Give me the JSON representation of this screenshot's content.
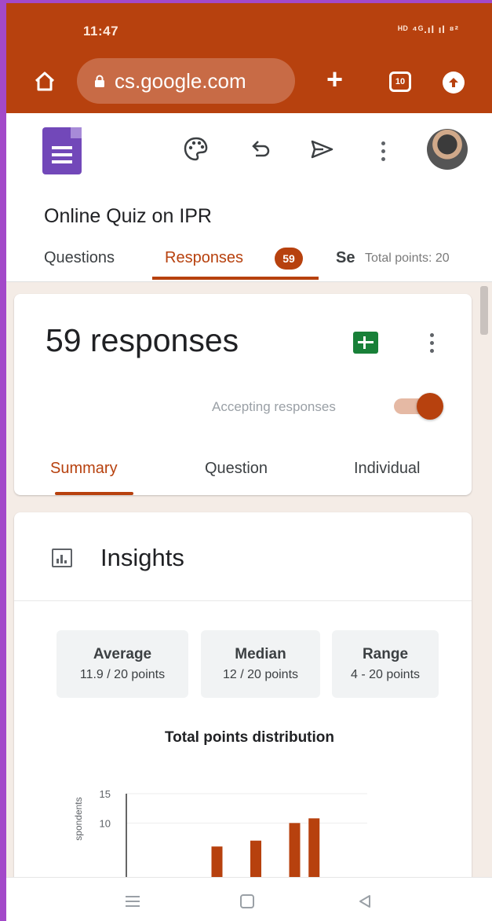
{
  "status_bar": {
    "time": "11:47",
    "icons_text": "ᴴᴰ ⁴ᴳ.ıl ıl ⁸²"
  },
  "browser": {
    "url": "cs.google.com",
    "tab_count": "10"
  },
  "form": {
    "title": "Online Quiz on IPR",
    "tabs": [
      {
        "label": "Questions"
      },
      {
        "label": "Responses",
        "badge": "59"
      },
      {
        "label": "Se"
      }
    ],
    "total_points": "Total points: 20"
  },
  "responses": {
    "count_label": "59 responses",
    "accepting_label": "Accepting responses",
    "accepting_on": true,
    "subtabs": [
      "Summary",
      "Question",
      "Individual"
    ]
  },
  "insights": {
    "title": "Insights",
    "stats": [
      {
        "label": "Average",
        "value": "11.9 / 20 points"
      },
      {
        "label": "Median",
        "value": "12 / 20 points"
      },
      {
        "label": "Range",
        "value": "4 - 20 points"
      }
    ]
  },
  "chart_data": {
    "type": "bar",
    "title": "Total points distribution",
    "ylabel": "spondents",
    "ylim": [
      0,
      15
    ],
    "yticks": [
      "15",
      "10"
    ],
    "bars": [
      {
        "x": 7,
        "value": 6
      },
      {
        "x": 10,
        "value": 7
      },
      {
        "x": 13,
        "value": 10
      },
      {
        "x": 14.5,
        "value": 10.8
      }
    ],
    "bar_color": "#b7410e"
  },
  "colors": {
    "accent": "#b7410e",
    "forms_purple": "#7248b9",
    "sheets_green": "#188038"
  }
}
